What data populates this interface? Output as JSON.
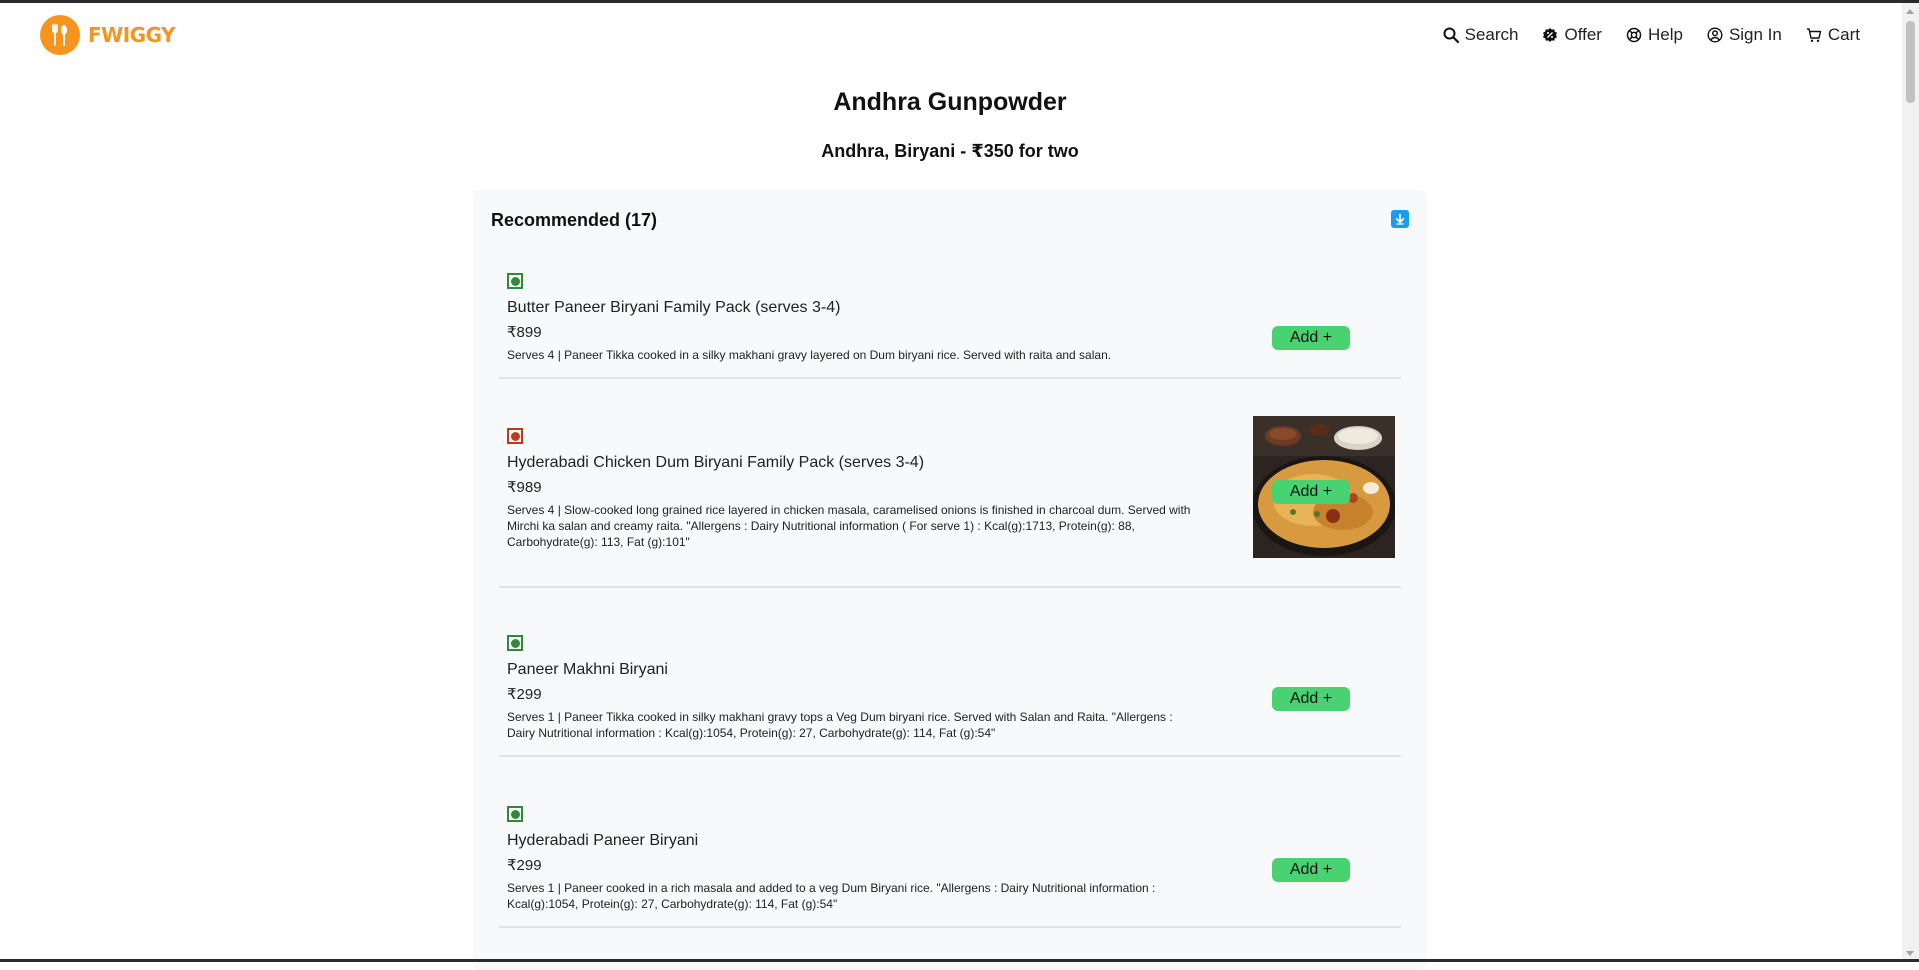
{
  "brand": {
    "name": "FWIGGY",
    "accent": "#f7941d"
  },
  "nav": {
    "search": "Search",
    "offer": "Offer",
    "help": "Help",
    "sign_in": "Sign In",
    "cart": "Cart"
  },
  "restaurant": {
    "name": "Andhra Gunpowder",
    "meta": "Andhra, Biryani - ₹350 for two"
  },
  "section": {
    "title": "Recommended (17)"
  },
  "items": [
    {
      "type": "veg",
      "name": "Butter Paneer Biryani Family Pack (serves 3-4)",
      "price": "₹899",
      "description": "Serves 4 | Paneer Tikka cooked in a silky makhani gravy layered on Dum biryani rice. Served with raita and salan.",
      "add_label": "Add +"
    },
    {
      "type": "non-veg",
      "name": "Hyderabadi Chicken Dum Biryani Family Pack (serves 3-4)",
      "price": "₹989",
      "description": "Serves 4 | Slow-cooked long grained rice layered in chicken masala, caramelised onions is finished in charcoal dum. Served with Mirchi ka salan and creamy raita. \"Allergens : Dairy Nutritional information ( For serve 1) : Kcal(g):1713, Protein(g): 88, Carbohydrate(g): 113, Fat (g):101\"",
      "add_label": "Add +"
    },
    {
      "type": "veg",
      "name": "Paneer Makhni Biryani",
      "price": "₹299",
      "description": "Serves 1 | Paneer Tikka cooked in silky makhani gravy tops a Veg Dum biryani rice. Served with Salan and Raita. \"Allergens : Dairy Nutritional information : Kcal(g):1054, Protein(g): 27, Carbohydrate(g): 114, Fat (g):54\"",
      "add_label": "Add +"
    },
    {
      "type": "veg",
      "name": "Hyderabadi Paneer Biryani",
      "price": "₹299",
      "description": "Serves 1 | Paneer cooked in a rich masala and added to a veg Dum Biryani rice. \"Allergens : Dairy Nutritional information : Kcal(g):1054, Protein(g): 27, Carbohydrate(g): 114, Fat (g):54\"",
      "add_label": "Add +"
    }
  ],
  "colors": {
    "veg": "#2e8b3a",
    "non_veg": "#c0391b",
    "add_button": "#48d271",
    "collapse_button": "#1a9cf0"
  }
}
